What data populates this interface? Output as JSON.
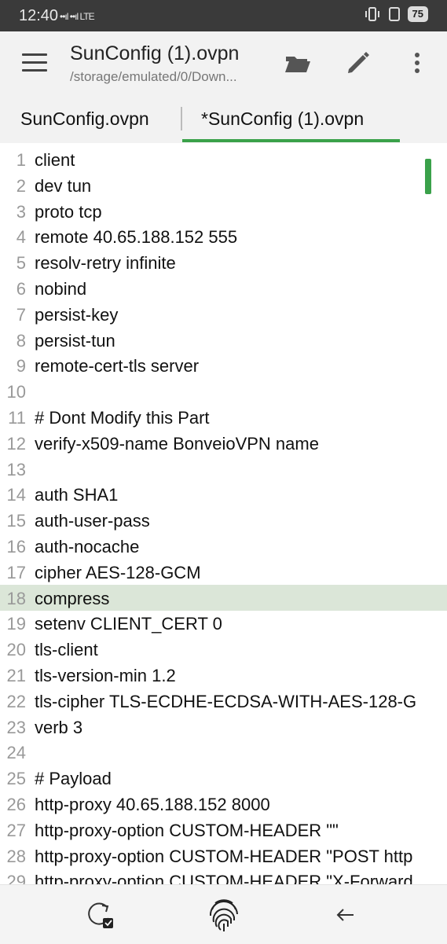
{
  "status": {
    "time": "12:40",
    "signal": "••ıl ••ıl LTE",
    "battery": "75"
  },
  "appbar": {
    "title": "SunConfig (1).ovpn",
    "subtitle": "/storage/emulated/0/Down..."
  },
  "tabs": [
    {
      "label": "SunConfig.ovpn"
    },
    {
      "label": "*SunConfig (1).ovpn"
    }
  ],
  "editor": {
    "highlight_line": 18,
    "lines": [
      {
        "n": "1",
        "text": "client"
      },
      {
        "n": "2",
        "text": "dev tun"
      },
      {
        "n": "3",
        "text": "proto tcp"
      },
      {
        "n": "4",
        "text": "remote 40.65.188.152 555"
      },
      {
        "n": "5",
        "text": "resolv-retry infinite"
      },
      {
        "n": "6",
        "text": "nobind"
      },
      {
        "n": "7",
        "text": "persist-key"
      },
      {
        "n": "8",
        "text": "persist-tun"
      },
      {
        "n": "9",
        "text": "remote-cert-tls server"
      },
      {
        "n": "10",
        "text": ""
      },
      {
        "n": "11",
        "text": "# Dont Modify this Part"
      },
      {
        "n": "12",
        "text": "verify-x509-name BonveioVPN name"
      },
      {
        "n": "13",
        "text": ""
      },
      {
        "n": "14",
        "text": "auth SHA1"
      },
      {
        "n": "15",
        "text": "auth-user-pass"
      },
      {
        "n": "16",
        "text": "auth-nocache"
      },
      {
        "n": "17",
        "text": "cipher AES-128-GCM"
      },
      {
        "n": "18",
        "text": "compress"
      },
      {
        "n": "19",
        "text": "setenv CLIENT_CERT 0"
      },
      {
        "n": "20",
        "text": "tls-client"
      },
      {
        "n": "21",
        "text": "tls-version-min 1.2"
      },
      {
        "n": "22",
        "text": "tls-cipher TLS-ECDHE-ECDSA-WITH-AES-128-G"
      },
      {
        "n": "23",
        "text": "verb 3"
      },
      {
        "n": "24",
        "text": ""
      },
      {
        "n": "25",
        "text": "# Payload"
      },
      {
        "n": "26",
        "text": "http-proxy 40.65.188.152 8000"
      },
      {
        "n": "27",
        "text": "http-proxy-option CUSTOM-HEADER \"\""
      },
      {
        "n": "28",
        "text": "http-proxy-option CUSTOM-HEADER \"POST http"
      },
      {
        "n": "29",
        "text": "http-proxy-option CUSTOM-HEADER \"X-Forward"
      }
    ]
  },
  "colors": {
    "accent": "#3aa14a",
    "highlight": "#dbe6d8",
    "statusbar": "#3a3a3a",
    "appbar": "#f2f2f2"
  }
}
